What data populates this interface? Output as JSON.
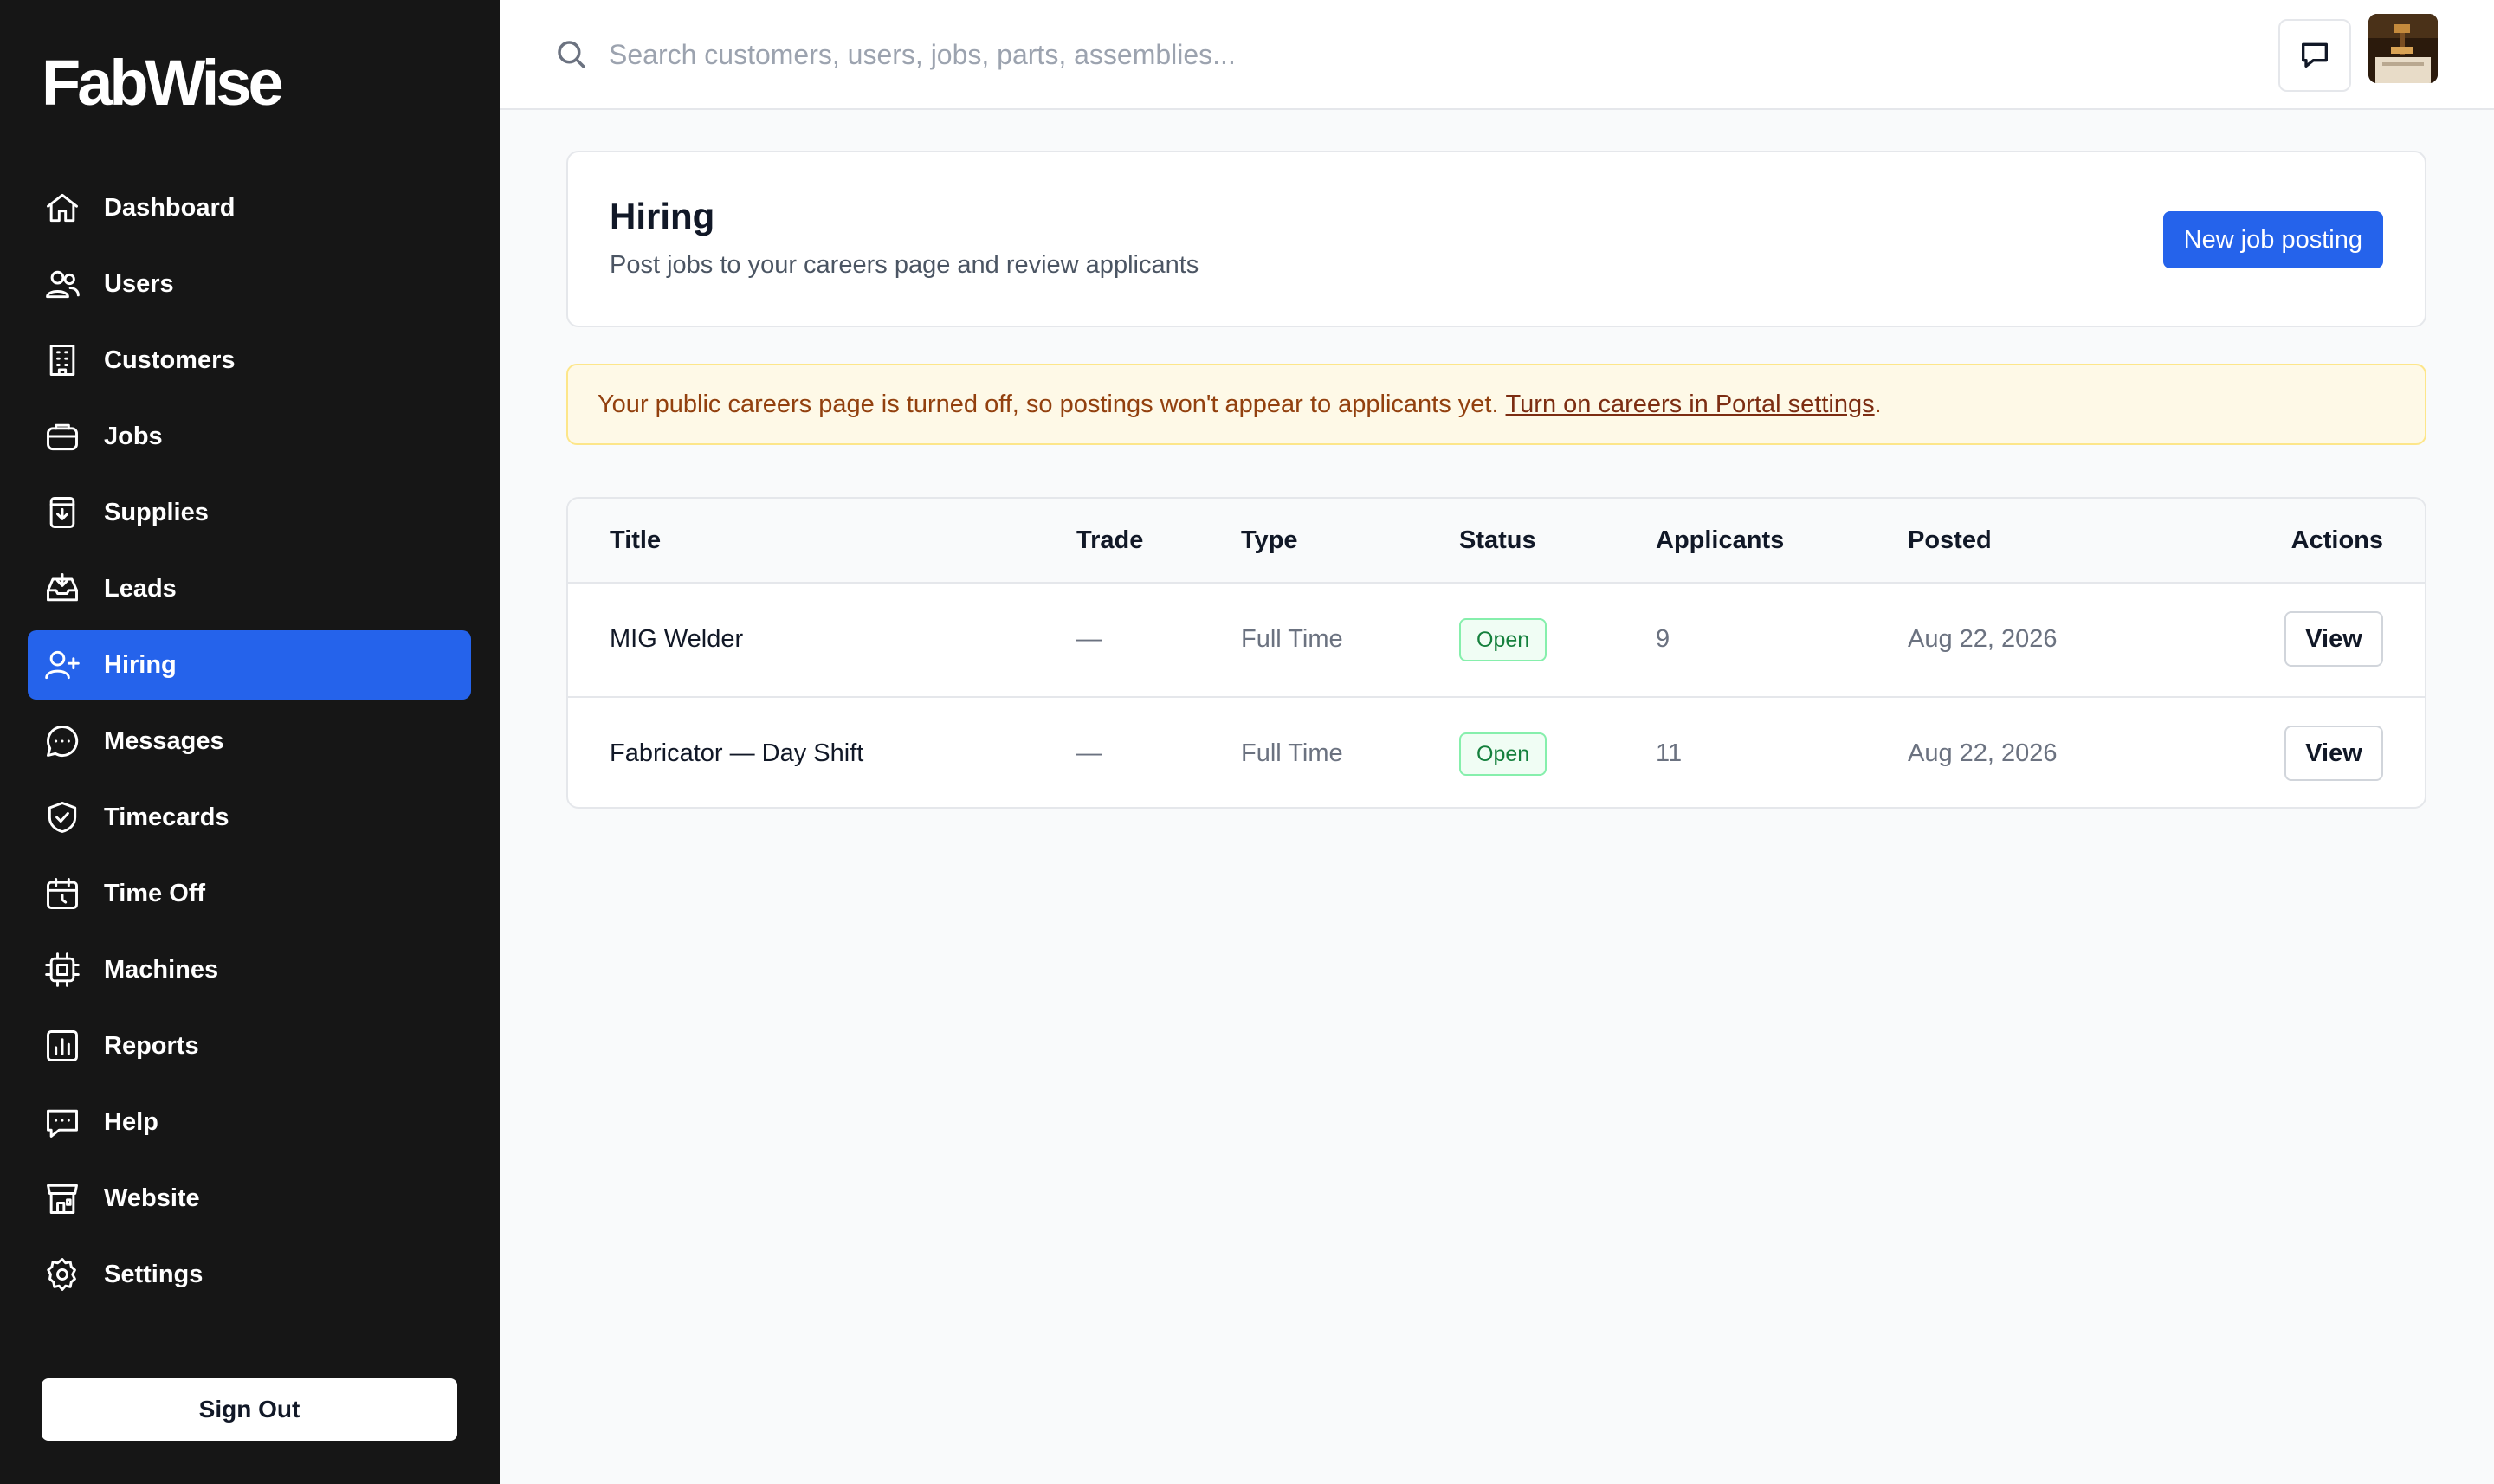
{
  "app": {
    "logo": "FabWise"
  },
  "sidebar": {
    "items": [
      {
        "label": "Dashboard",
        "icon": "home-icon"
      },
      {
        "label": "Users",
        "icon": "users-icon"
      },
      {
        "label": "Customers",
        "icon": "building-icon"
      },
      {
        "label": "Jobs",
        "icon": "briefcase-icon"
      },
      {
        "label": "Supplies",
        "icon": "download-box-icon"
      },
      {
        "label": "Leads",
        "icon": "inbox-icon"
      },
      {
        "label": "Hiring",
        "icon": "user-plus-icon",
        "active": true
      },
      {
        "label": "Messages",
        "icon": "chat-bubble-icon"
      },
      {
        "label": "Timecards",
        "icon": "shield-check-icon"
      },
      {
        "label": "Time Off",
        "icon": "calendar-clock-icon"
      },
      {
        "label": "Machines",
        "icon": "cpu-icon"
      },
      {
        "label": "Reports",
        "icon": "bar-chart-icon"
      },
      {
        "label": "Help",
        "icon": "help-chat-icon"
      },
      {
        "label": "Website",
        "icon": "storefront-icon"
      },
      {
        "label": "Settings",
        "icon": "gear-icon"
      }
    ],
    "sign_out": "Sign Out"
  },
  "topbar": {
    "search_placeholder": "Search customers, users, jobs, parts, assemblies..."
  },
  "page": {
    "title": "Hiring",
    "subtitle": "Post jobs to your careers page and review applicants",
    "new_button": "New job posting"
  },
  "alert": {
    "text": "Your public careers page is turned off, so postings won't appear to applicants yet.",
    "link": "Turn on careers in Portal settings",
    "suffix": "."
  },
  "table": {
    "headers": {
      "title": "Title",
      "trade": "Trade",
      "type": "Type",
      "status": "Status",
      "applicants": "Applicants",
      "posted": "Posted",
      "actions": "Actions"
    },
    "rows": [
      {
        "title": "MIG Welder",
        "trade": "—",
        "type": "Full Time",
        "status": "Open",
        "applicants": "9",
        "posted": "Aug 22, 2026",
        "action": "View"
      },
      {
        "title": "Fabricator — Day Shift",
        "trade": "—",
        "type": "Full Time",
        "status": "Open",
        "applicants": "11",
        "posted": "Aug 22, 2026",
        "action": "View"
      }
    ]
  },
  "colors": {
    "accent": "#2563eb",
    "sidebar_bg": "#161616",
    "alert_bg": "#fef9e7",
    "open_badge": "#15803d"
  }
}
